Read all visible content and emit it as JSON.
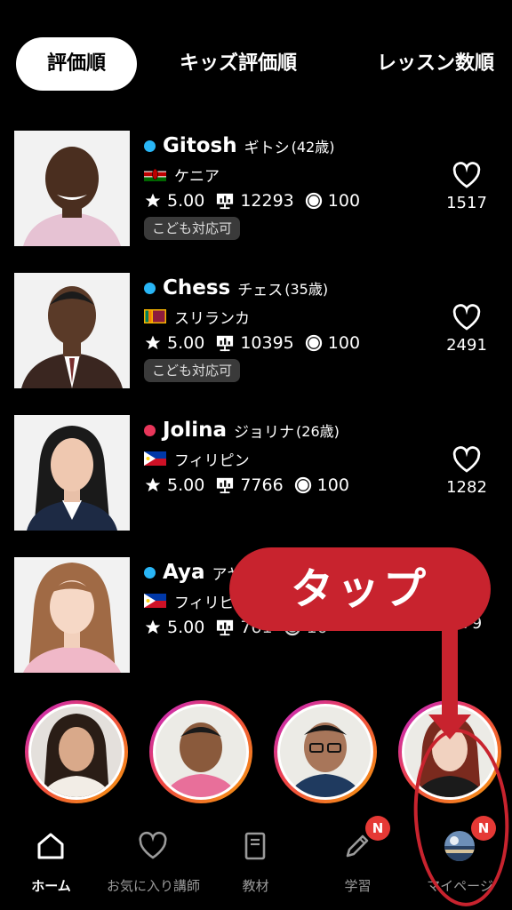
{
  "tabs": [
    {
      "label": "評価順",
      "active": true
    },
    {
      "label": "キッズ評価順",
      "active": false
    },
    {
      "label": "レッスン数順",
      "active": false
    }
  ],
  "teachers": [
    {
      "name": "Gitosh",
      "kana": "ギトシ",
      "age": "(42歳)",
      "status_color": "#29b6f6",
      "country": "ケニア",
      "country_flag": "kenya-flag",
      "rating": "5.00",
      "lessons": "12293",
      "coins": "100",
      "badge": "こども対応可",
      "favorites": "1517"
    },
    {
      "name": "Chess",
      "kana": "チェス",
      "age": "(35歳)",
      "status_color": "#29b6f6",
      "country": "スリランカ",
      "country_flag": "sri-lanka-flag",
      "rating": "5.00",
      "lessons": "10395",
      "coins": "100",
      "badge": "こども対応可",
      "favorites": "2491"
    },
    {
      "name": "Jolina",
      "kana": "ジョリナ",
      "age": "(26歳)",
      "status_color": "#e8365a",
      "country": "フィリピン",
      "country_flag": "philippines-flag",
      "rating": "5.00",
      "lessons": "7766",
      "coins": "100",
      "favorites": "1282"
    },
    {
      "name": "Aya",
      "kana": "アヤ",
      "age": "",
      "status_color": "#29b6f6",
      "country": "フィリピ",
      "country_flag": "philippines-flag",
      "rating": "5.00",
      "lessons": "761",
      "coins": "10",
      "favorites": "179"
    }
  ],
  "callout": {
    "text": "タップ"
  },
  "nav": [
    {
      "label": "ホーム",
      "icon": "home-icon",
      "active": true
    },
    {
      "label": "お気に入り講師",
      "icon": "heart-icon",
      "active": false
    },
    {
      "label": "教材",
      "icon": "book-icon",
      "active": false
    },
    {
      "label": "学習",
      "icon": "pencil-icon",
      "active": false,
      "badge": "N"
    },
    {
      "label": "マイページ",
      "icon": "avatar-icon",
      "active": false,
      "badge": "N"
    }
  ],
  "colors": {
    "accent_red": "#c8232e",
    "online_blue": "#29b6f6",
    "offline_pink": "#e8365a",
    "badge_red": "#e53935"
  }
}
